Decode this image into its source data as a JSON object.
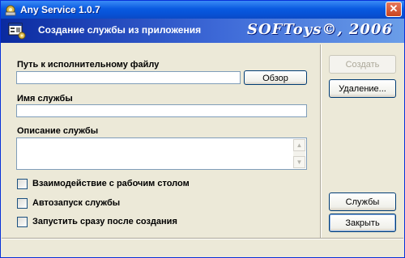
{
  "window": {
    "title": "Any Service 1.0.7"
  },
  "banner": {
    "subtitle": "Создание службы из приложения",
    "brand": "SOFToys©, 2006"
  },
  "form": {
    "exe_label": "Путь к исполнительному файлу",
    "exe_value": "",
    "browse_label": "Обзор",
    "name_label": "Имя службы",
    "name_value": "",
    "desc_label": "Описание службы",
    "desc_value": ""
  },
  "options": [
    {
      "label": "Взаимодействие с рабочим столом",
      "checked": false
    },
    {
      "label": "Автозапуск службы",
      "checked": false
    },
    {
      "label": "Запустить сразу после создания",
      "checked": false
    }
  ],
  "actions": {
    "create": "Создать",
    "delete": "Удаление...",
    "services": "Службы",
    "close": "Закрыть"
  },
  "colors": {
    "titlebar": "#0a5ae0",
    "window_bg": "#ece9d8",
    "field_border": "#7f9db9"
  },
  "icons": {
    "app": "gear-keyboard-icon",
    "banner": "window-cog-icon",
    "close": "close-icon"
  }
}
